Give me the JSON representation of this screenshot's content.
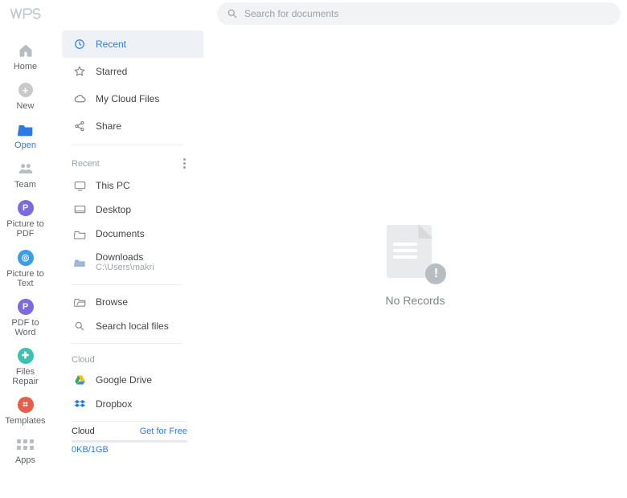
{
  "search": {
    "placeholder": "Search for documents"
  },
  "leftnav": {
    "home": "Home",
    "new": "New",
    "open": "Open",
    "team": "Team",
    "pic_to_pdf": "Picture to PDF",
    "pic_to_text": "Picture to Text",
    "pdf_to_word": "PDF to Word",
    "files_repair": "Files Repair",
    "templates": "Templates",
    "apps": "Apps"
  },
  "openpanel": {
    "tabs": {
      "recent": "Recent",
      "starred": "Starred",
      "my_cloud": "My Cloud Files",
      "share": "Share"
    },
    "recent_header": "Recent",
    "locations": {
      "this_pc": "This PC",
      "desktop": "Desktop",
      "documents": "Documents",
      "downloads": "Downloads",
      "downloads_path": "C:\\Users\\makri",
      "browse": "Browse",
      "search_local": "Search local files"
    },
    "cloud_header": "Cloud",
    "google_drive": "Google Drive",
    "dropbox": "Dropbox",
    "cloud_footer": {
      "label": "Cloud",
      "getfree": "Get for Free",
      "usage": "0KB/1GB"
    }
  },
  "content": {
    "empty": "No Records"
  }
}
